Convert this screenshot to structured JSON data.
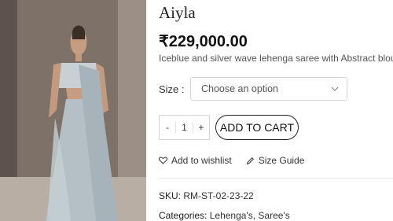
{
  "product": {
    "title": "Aiyla",
    "price": "₹229,000.00",
    "description": "Iceblue and silver wave lehenga saree with Abstract blouse"
  },
  "variation": {
    "size_label": "Size",
    "size_colon": ":",
    "select_placeholder": "Choose an option"
  },
  "cart": {
    "minus": "-",
    "quantity": "1",
    "plus": "+",
    "add_to_cart": "ADD TO CART"
  },
  "actions": {
    "wishlist": "Add to wishlist",
    "size_guide": "Size Guide"
  },
  "meta": {
    "sku_label": "SKU:",
    "sku_value": "RM-ST-02-23-22",
    "categories_label": "Categories:",
    "categories": [
      {
        "name": "Lehenga's",
        "sep": ","
      },
      {
        "name": "Saree's",
        "sep": ""
      }
    ]
  },
  "icons": {
    "wishlist": "heart-icon",
    "size_guide": "pencil-icon",
    "select": "chevron-down-icon"
  }
}
